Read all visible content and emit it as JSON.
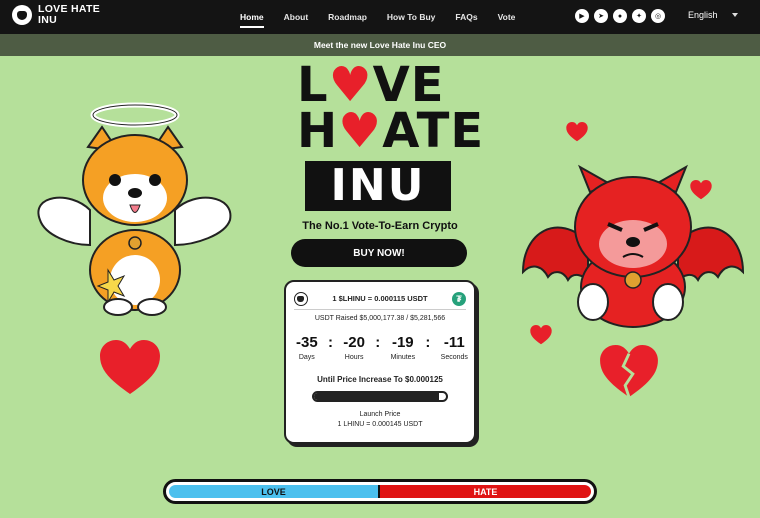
{
  "brand": {
    "name": "LOVE HATE INU"
  },
  "nav": {
    "items": [
      "Home",
      "About",
      "Roadmap",
      "How To Buy",
      "FAQs",
      "Vote"
    ],
    "active": "Home",
    "language": "English"
  },
  "socials": [
    "youtube-icon",
    "telegram-icon",
    "discord-icon",
    "twitter-icon",
    "instagram-icon"
  ],
  "banner": {
    "text": "Meet the new Love Hate Inu CEO"
  },
  "hero": {
    "title_line1_a": "L",
    "title_line1_b": "VE",
    "title_line2_a": "H",
    "title_line2_b": "ATE",
    "title_line3": "INU",
    "tagline": "The No.1 Vote-To-Earn Crypto",
    "buy_label": "BUY NOW!"
  },
  "presale": {
    "rate": "1 $LHINU = 0.000115 USDT",
    "raised": "USDT Raised $5,000,177.38 / $5,281,566",
    "raised_fraction": 0.947,
    "countdown": [
      {
        "value": "-35",
        "label": "Days"
      },
      {
        "value": "-20",
        "label": "Hours"
      },
      {
        "value": "-19",
        "label": "Minutes"
      },
      {
        "value": "-11",
        "label": "Seconds"
      }
    ],
    "until_text": "Until Price Increase To $0.000125",
    "launch_label": "Launch Price",
    "launch_rate": "1 LHINU = 0.000145 USDT"
  },
  "vote": {
    "love_label": "LOVE",
    "hate_label": "HATE",
    "love_share": 0.5
  },
  "colors": {
    "background": "#b5e09a",
    "accent_red": "#e8202a",
    "love_blue": "#4cc0ee",
    "hate_red": "#e01414"
  }
}
